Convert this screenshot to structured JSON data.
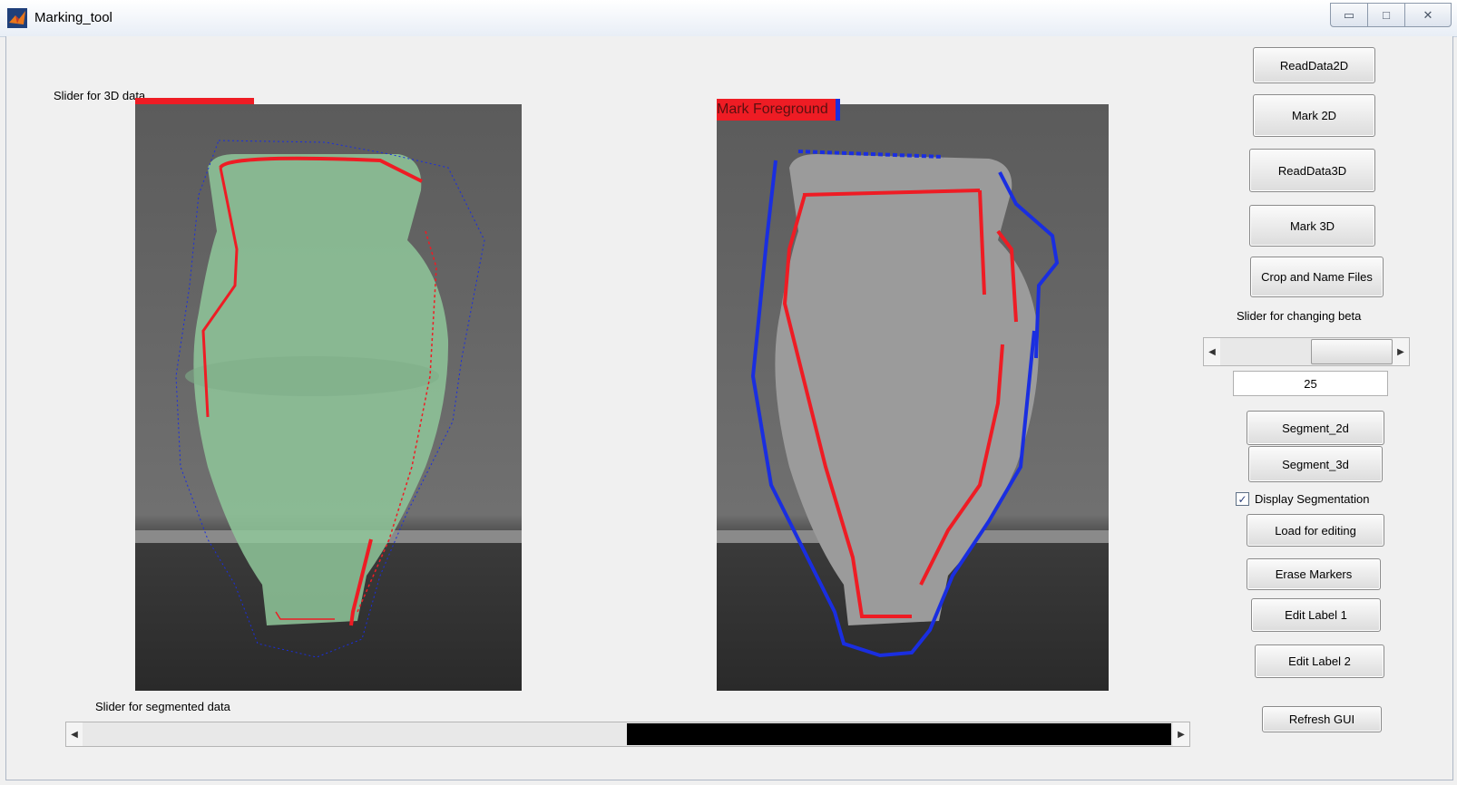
{
  "window": {
    "title": "Marking_tool",
    "minimize_icon": "minimize-icon",
    "maximize_icon": "maximize-icon",
    "close_icon": "close-icon"
  },
  "left_panel": {
    "slider_3d_label": "Slider for 3D data"
  },
  "right_panel": {
    "mark_label": "Mark Foreground"
  },
  "bottom": {
    "slider_segmented_label": "Slider for segmented data"
  },
  "controls": {
    "read2d": "ReadData2D",
    "mark2d": "Mark 2D",
    "read3d": "ReadData3D",
    "mark3d": "Mark 3D",
    "crop": "Crop and Name Files",
    "beta_label": "Slider for changing beta",
    "beta_value": "25",
    "seg2d": "Segment_2d",
    "seg3d": "Segment_3d",
    "display_seg": "Display Segmentation",
    "load_edit": "Load for editing",
    "erase": "Erase Markers",
    "edit1": "Edit Label 1",
    "edit2": "Edit Label 2",
    "refresh": "Refresh GUI"
  },
  "colors": {
    "foreground_marker": "#ee1c24",
    "background_marker": "#1a2ee0",
    "segmentation_overlay": "#8fc79a"
  },
  "display_segmentation_checked": true
}
